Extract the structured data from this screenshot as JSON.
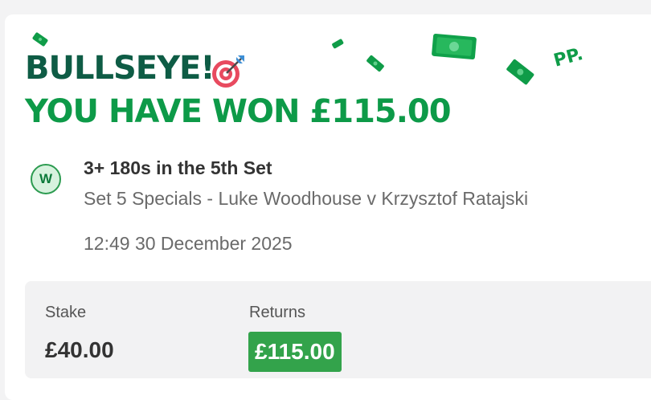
{
  "header": {
    "line1": "BULLSEYE!",
    "line2": "YOU HAVE WON £115.00",
    "target_icon": "dartboard-target-icon"
  },
  "decoration": {
    "money_icon": "banknote-icon",
    "watermark_text": "PP."
  },
  "bet": {
    "result_badge": "W",
    "selection": "3+ 180s in the 5th Set",
    "market": "Set 5 Specials - Luke Woodhouse v Krzysztof Ratajski",
    "placed_time": "12:49 30 December 2025"
  },
  "summary": {
    "stake_label": "Stake",
    "stake_value": "£40.00",
    "returns_label": "Returns",
    "returns_value": "£115.00"
  },
  "colors": {
    "headline_dark": "#0e5c45",
    "headline_green": "#0d9a48",
    "returns_bg": "#33a34b",
    "badge_border": "#2c9b50",
    "panel_bg": "#f2f2f3"
  }
}
